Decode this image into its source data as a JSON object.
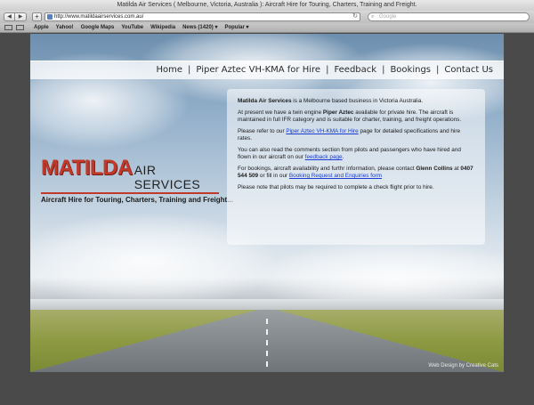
{
  "window": {
    "title": "Matilda Air Services ( Melbourne, Victoria, Australia ): Aircraft Hire for Touring, Charters, Training and Freight."
  },
  "toolbar": {
    "back_icon": "back-arrow-icon",
    "forward_icon": "forward-arrow-icon",
    "add_label": "+",
    "url": "http://www.matildaairservices.com.au/",
    "reload_glyph": "↻",
    "search_placeholder": "Google"
  },
  "bookmarks": {
    "items": [
      "Apple",
      "Yahoo!",
      "Google Maps",
      "YouTube",
      "Wikipedia",
      "News (1420) ▾",
      "Popular ▾"
    ]
  },
  "site": {
    "nav": [
      "Home",
      "Piper Aztec VH-KMA for Hire",
      "Feedback",
      "Bookings",
      "Contact Us"
    ],
    "logo": {
      "name": "MATILDA",
      "suffix": "AIR SERVICES",
      "tagline": "Aircraft Hire for Touring, Charters, Training and Freight..."
    },
    "content": {
      "p1_b": "Matilda Air Services",
      "p1_rest": " is a Melbourne based business in Victoria Australia.",
      "p2_a": "At present we have a twin engine ",
      "p2_b": "Piper Aztec",
      "p2_c": " available for private hire. The aircraft is maintained in full IFR category and is suitable for charter, training, and freight operations.",
      "p3_a": "Please refer to our ",
      "p3_link": "Piper Aztec VH-KMA for Hire",
      "p3_c": " page for detailed specifications and hire rates.",
      "p4_a": "You can also read the comments section from pilots and passengers who have hired and flown in our aircraft on our ",
      "p4_link": "feedback page",
      "p4_c": ".",
      "p5_a": "For bookings, aircraft availability and furthr information, please contact ",
      "p5_b": "Glenn Collins",
      "p5_c": " at ",
      "p5_d": "0407 544 509",
      "p5_e": " or fill in our ",
      "p5_link": "Booking Request and Enquiries form",
      "p6": "Please note that pilots may be required to complete a check flight prior to hire."
    },
    "credit": "Web Design by Creative Cats"
  },
  "colors": {
    "brand_red": "#c0392b",
    "link_blue": "#1a3bd4"
  }
}
